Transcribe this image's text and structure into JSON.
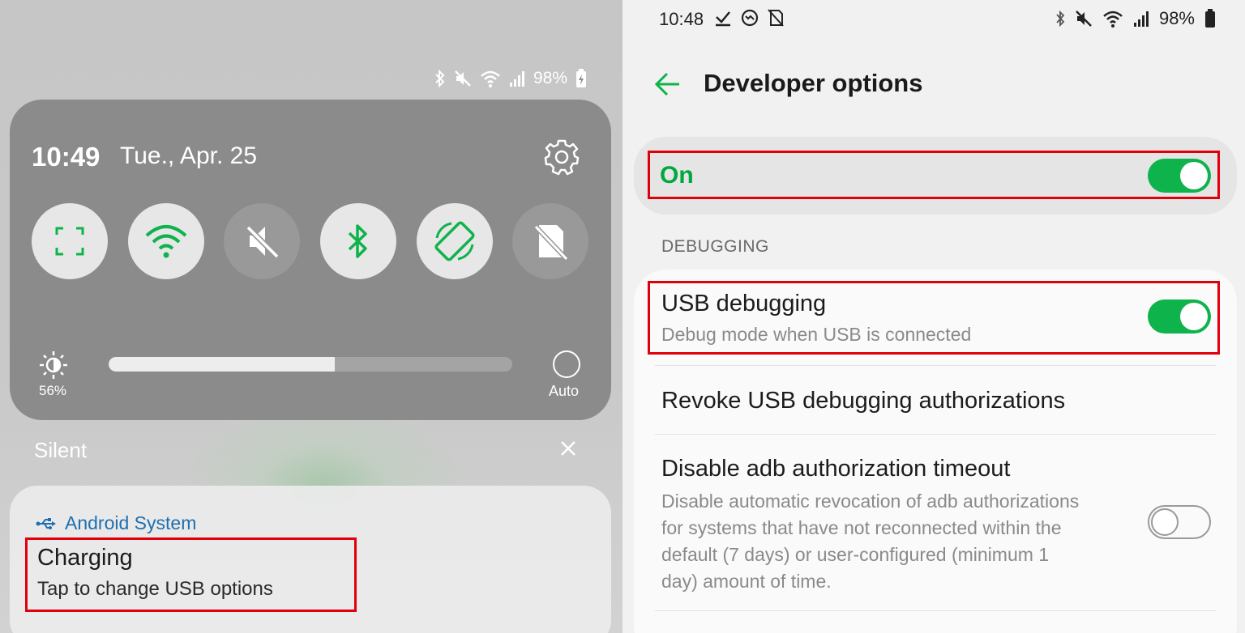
{
  "left": {
    "status_bar": {
      "battery_text": "98%"
    },
    "quick_settings": {
      "time": "10:49",
      "date": "Tue., Apr. 25",
      "tiles": [
        {
          "name": "screenshot",
          "state": "on"
        },
        {
          "name": "wifi",
          "state": "on"
        },
        {
          "name": "sound-muted",
          "state": "off"
        },
        {
          "name": "bluetooth",
          "state": "on"
        },
        {
          "name": "auto-rotate",
          "state": "on"
        },
        {
          "name": "sim-card",
          "state": "off"
        }
      ],
      "brightness_percent_label": "56%",
      "brightness_level": 0.56,
      "auto_label": "Auto"
    },
    "silent_header": "Silent",
    "notification": {
      "app_name": "Android System",
      "title": "Charging",
      "text": "Tap to change USB options"
    }
  },
  "right": {
    "status_bar": {
      "time": "10:48",
      "battery_text": "98%"
    },
    "title": "Developer options",
    "master_switch": {
      "label": "On",
      "state": "on"
    },
    "section_header": "DEBUGGING",
    "rows": [
      {
        "title": "USB debugging",
        "subtitle": "Debug mode when USB is connected",
        "toggle": "on"
      },
      {
        "title": "Revoke USB debugging authorizations"
      },
      {
        "title": "Disable adb authorization timeout",
        "subtitle_lines": [
          "Disable automatic revocation of adb authorizations",
          "for systems that have not reconnected within the",
          "default (7 days) or user-configured (minimum 1",
          "day) amount of time."
        ],
        "toggle": "off"
      }
    ]
  },
  "colors": {
    "accent_green": "#0fb34c",
    "highlight_red": "#e0000b",
    "link_blue": "#1f6fb0"
  }
}
